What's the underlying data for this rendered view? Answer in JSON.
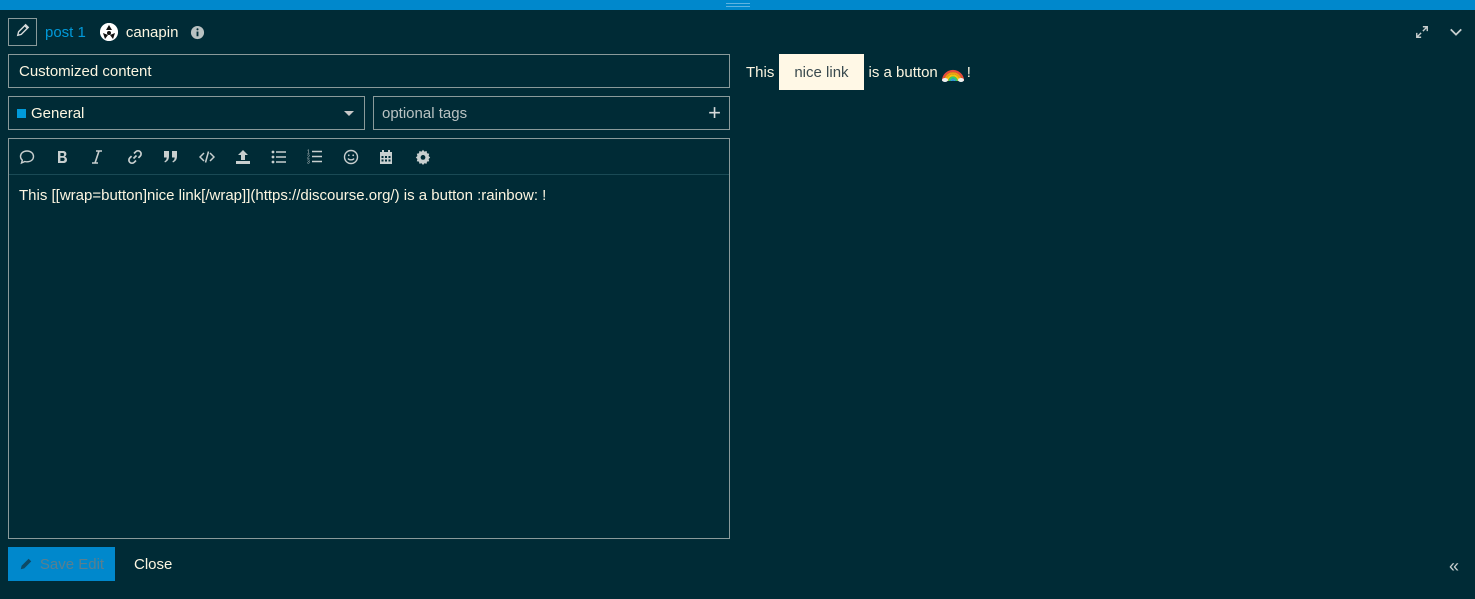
{
  "header": {
    "post_link": "post 1",
    "username": "canapin"
  },
  "title": {
    "value": "Customized content"
  },
  "category": {
    "selected": "General",
    "color": "#0099d9"
  },
  "tags": {
    "placeholder": "optional tags"
  },
  "toolbar": {
    "buttons": [
      "quote",
      "bold",
      "italic",
      "link",
      "blockquote",
      "code",
      "upload",
      "bullet-list",
      "ordered-list",
      "emoji",
      "calendar",
      "settings"
    ]
  },
  "editor": {
    "content": "This [[wrap=button]nice link[/wrap]](https://discourse.org/) is a button :rainbow: !"
  },
  "preview": {
    "prefix": "This",
    "button_label": "nice link",
    "suffix": "is a button",
    "end": "!"
  },
  "footer": {
    "save_label": "Save Edit",
    "close_label": "Close"
  },
  "colors": {
    "background": "#002b36",
    "accent": "#0088cc",
    "text": "#fcf6e1"
  }
}
